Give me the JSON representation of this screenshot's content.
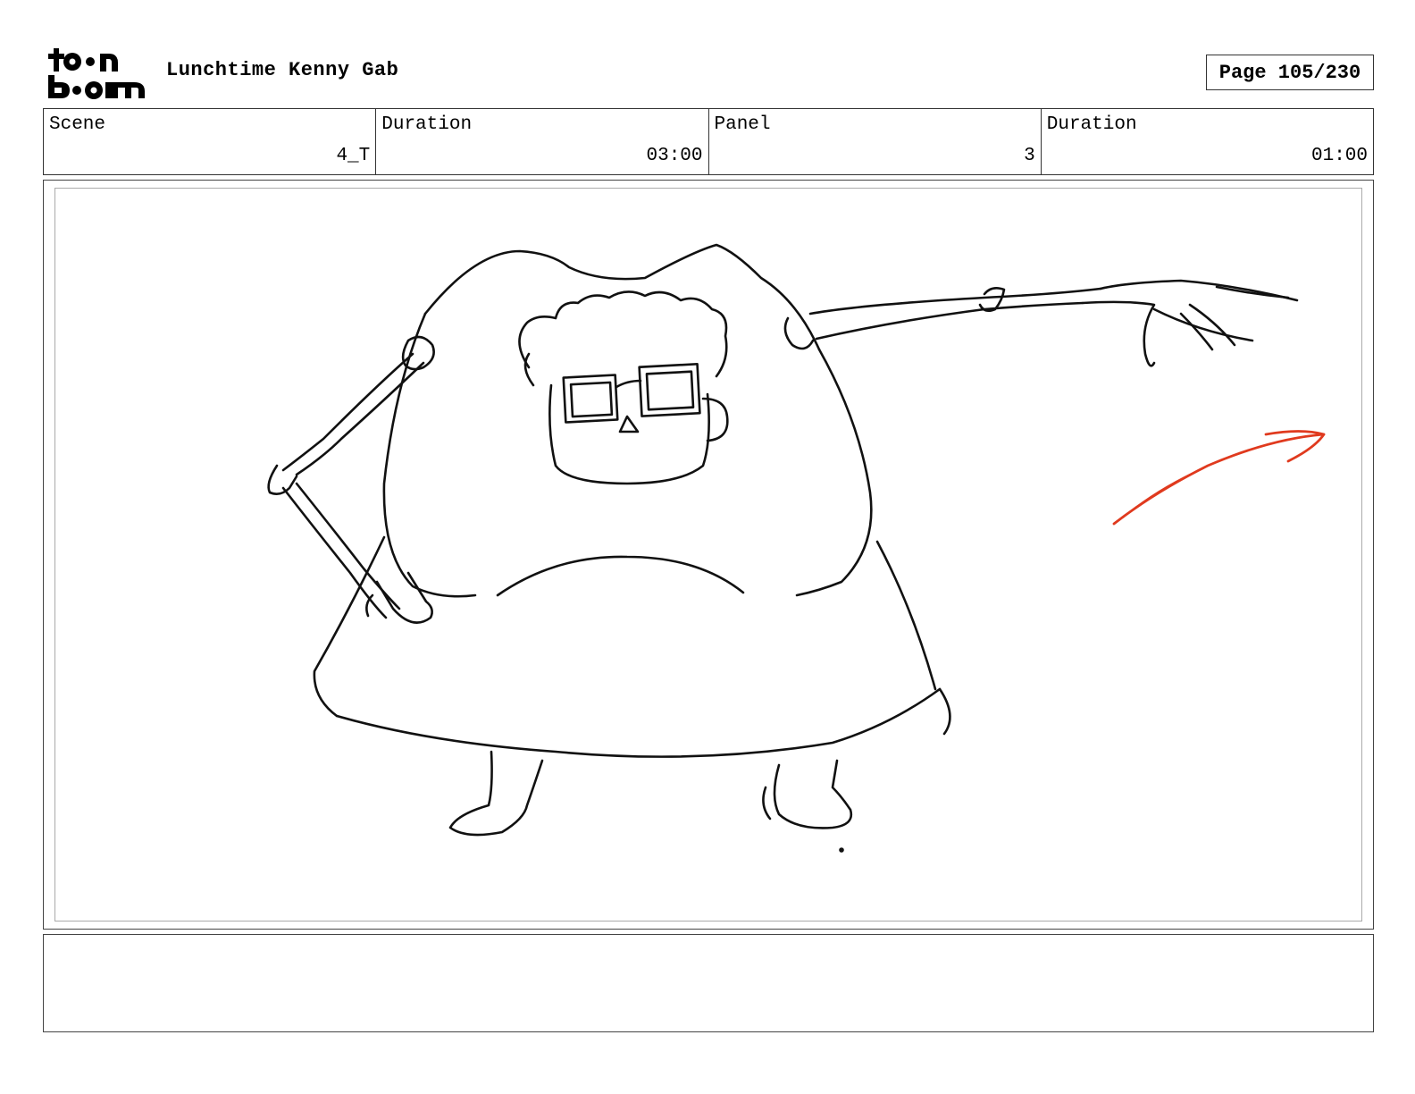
{
  "header": {
    "logo_text": "toon boom",
    "title": "Lunchtime Kenny Gab",
    "page": "Page 105/230"
  },
  "info": {
    "scene_label": "Scene",
    "scene_value": "4_T",
    "scene_duration_label": "Duration",
    "scene_duration_value": "03:00",
    "panel_label": "Panel",
    "panel_value": "3",
    "panel_duration_label": "Duration",
    "panel_duration_value": "01:00"
  },
  "notes": {
    "text": ""
  },
  "colors": {
    "motion_arrow": "#e03a1e",
    "ink": "#111111"
  }
}
